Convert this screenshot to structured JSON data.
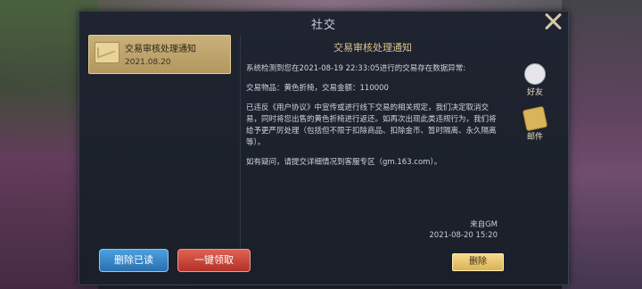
{
  "window": {
    "title": "社交",
    "close_icon": "close-icon"
  },
  "mail_list": [
    {
      "title": "交易审核处理通知",
      "date": "2021.08.20",
      "icon": "envelope-icon"
    }
  ],
  "message": {
    "title": "交易审核处理通知",
    "paragraphs": [
      "系统检测到您在2021-08-19 22:33:05进行的交易存在数据异常:",
      "交易物品：黄色折椅，交易金额：110000",
      "已违反《用户协议》中宣传或进行线下交易的相关规定，我们决定取消交易，同时将您出售的黄色折椅进行返还。如再次出现此类违规行为，我们将给予更严厉处理（包括但不限于扣除商品、扣除金币、暂时隔离、永久隔离等）。",
      "如有疑问，请提交详细情况到客服专区（gm.163.com）。"
    ],
    "sender": "来自GM",
    "timestamp": "2021-08-20  15:20"
  },
  "side_tabs": [
    {
      "label": "好友",
      "icon": "friends-icon"
    },
    {
      "label": "邮件",
      "icon": "mail-icon"
    }
  ],
  "buttons": {
    "delete_read": "删除已读",
    "claim_all": "一键领取",
    "delete": "删除"
  },
  "colors": {
    "panel_bg": "#1f2430",
    "selected_item": "#c9b07a",
    "title_gold": "#d9c38f",
    "blue_button": "#2b6fb0",
    "red_button": "#b23228",
    "yellow_button": "#d9b358"
  }
}
